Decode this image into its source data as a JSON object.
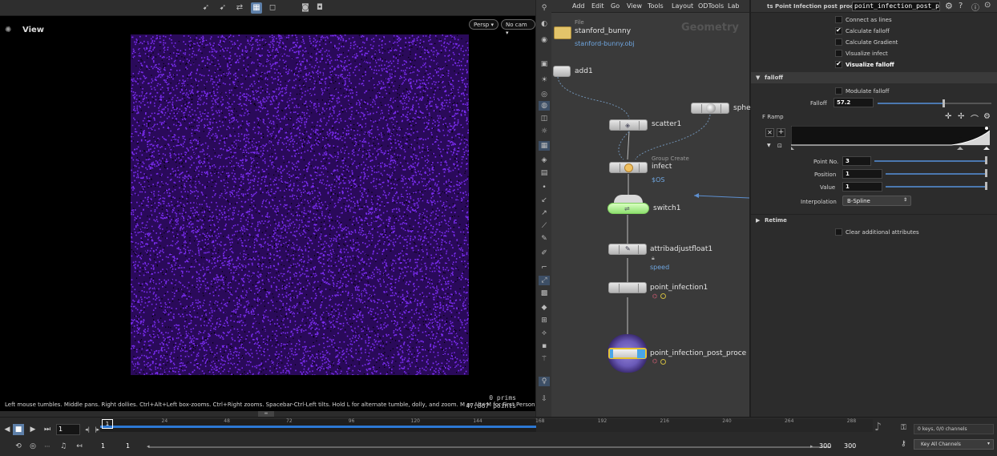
{
  "viewport": {
    "title": "View",
    "camera_mode": "Persp",
    "camera_name": "No cam",
    "help_text": "Left mouse tumbles. Middle pans. Right dollies. Ctrl+Alt+Left box-zooms. Ctrl+Right zooms. Spacebar-Ctrl-Left tilts. Hold L for alternate tumble, dolly, and zoom. M or Alt+M for First Person Navigation.",
    "prims_stat": "0  prims",
    "points_stat": "47,867 points",
    "point_color": "#7a2cf0"
  },
  "network": {
    "menu": [
      "Add",
      "Edit",
      "Go",
      "View",
      "Tools",
      "Layout",
      "ODTools",
      "Lab"
    ],
    "context_label": "Geometry",
    "nodes": {
      "file": {
        "comment": "File",
        "name": "stanford_bunny",
        "sub": "stanford-bunny.obj"
      },
      "add": {
        "name": "add1"
      },
      "sphere": {
        "name": "sphe"
      },
      "scatter": {
        "name": "scatter1"
      },
      "infect": {
        "comment": "Group Create",
        "name": "infect",
        "sub": "$OS"
      },
      "switch": {
        "name": "switch1"
      },
      "attrib": {
        "name": "attribadjustfloat1",
        "sub": "speed"
      },
      "pinf": {
        "name": "point_infection1"
      },
      "ppost": {
        "name": "point_infection_post_proce"
      }
    }
  },
  "params": {
    "header_title": "ts Point Infection post process",
    "header_node": "point_infection_post_pr",
    "toggles": [
      {
        "label": "Connect as lines",
        "checked": false
      },
      {
        "label": "Calculate falloff",
        "checked": true
      },
      {
        "label": "Calculate Gradient",
        "checked": false
      },
      {
        "label": "Visualize infect",
        "checked": false
      },
      {
        "label": "Visualize falloff",
        "checked": true
      }
    ],
    "falloff_section": "falloff",
    "modulate_label": "Modulate falloff",
    "falloff_label": "Falloff",
    "falloff_value": "57.2",
    "falloff_fraction": 0.57,
    "framp_label": "F Ramp",
    "point_no_label": "Point No.",
    "point_no_value": "3",
    "position_label": "Position",
    "position_value": "1",
    "value_label": "Value",
    "value_value": "1",
    "interpolation_label": "Interpolation",
    "interpolation_value": "B-Spline",
    "retime_section": "Retime",
    "clear_label": "Clear additional attributes"
  },
  "timeline": {
    "current_frame": "1",
    "ticks": [
      "1",
      "24",
      "48",
      "72",
      "96",
      "120",
      "144",
      "168",
      "192",
      "216",
      "240",
      "264",
      "288"
    ],
    "range_start": "1",
    "range_start2": "1",
    "range_end": "300",
    "range_end2": "300",
    "keys_info": "0 keys, 0/0 channels",
    "key_all": "Key All Channels"
  }
}
